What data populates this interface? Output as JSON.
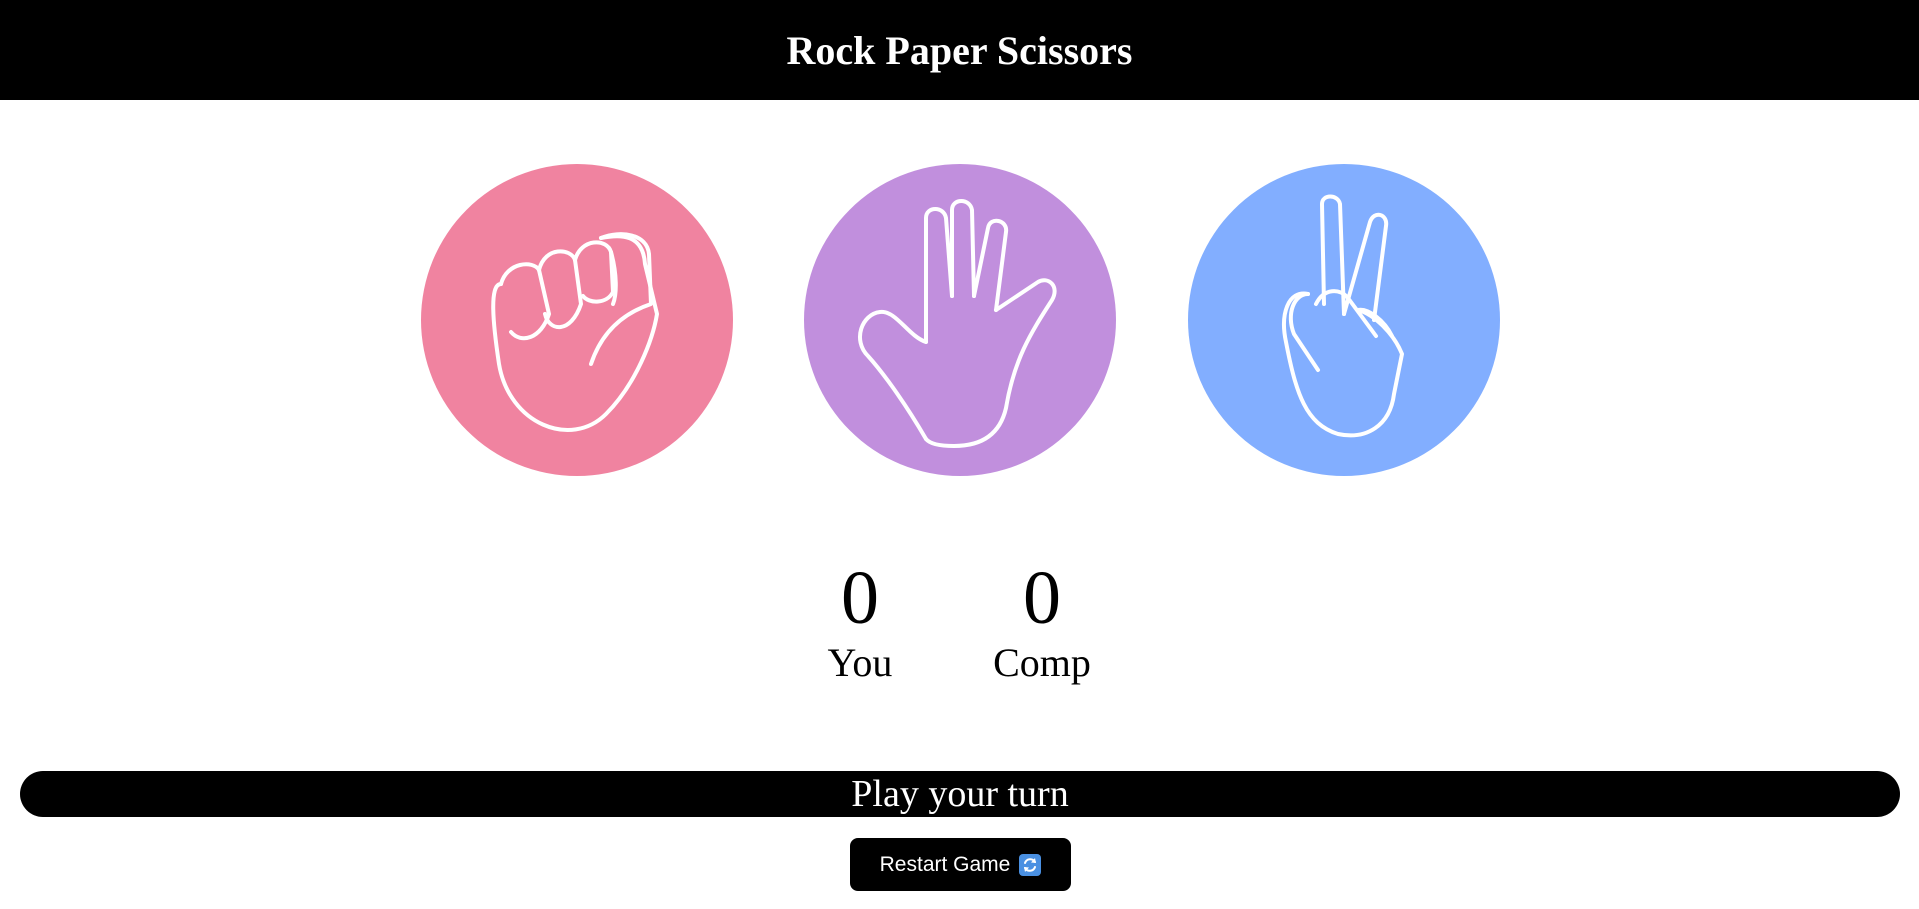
{
  "header": {
    "title": "Rock Paper Scissors"
  },
  "choices": [
    {
      "id": "rock",
      "icon": "fist-icon",
      "color": "#f083a0"
    },
    {
      "id": "paper",
      "icon": "open-hand-icon",
      "color": "#c18fdd"
    },
    {
      "id": "scissors",
      "icon": "peace-hand-icon",
      "color": "#82aeff"
    }
  ],
  "scores": {
    "user": {
      "value": "0",
      "label": "You"
    },
    "comp": {
      "value": "0",
      "label": "Comp"
    }
  },
  "message": "Play your turn",
  "restart": {
    "label": "Restart Game",
    "icon": "refresh-icon",
    "icon_color": "#4a90e2"
  }
}
